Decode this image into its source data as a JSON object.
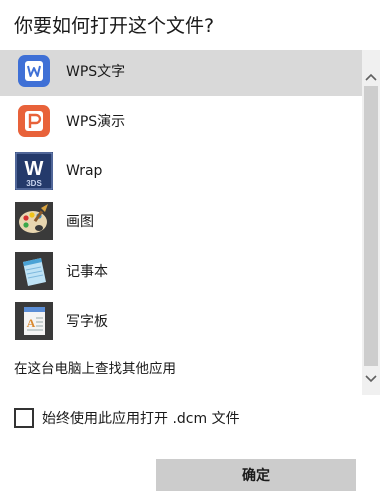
{
  "dialog": {
    "title": "你要如何打开这个文件?"
  },
  "apps": [
    {
      "label": "WPS文字",
      "icon": "wps-writer-icon",
      "color": "#3f70d6",
      "selected": true
    },
    {
      "label": "WPS演示",
      "icon": "wps-presentation-icon",
      "color": "#e8623a",
      "selected": false
    },
    {
      "label": "Wrap",
      "icon": "wrap-3ds-icon",
      "color": "#243a6b",
      "selected": false
    },
    {
      "label": "画图",
      "icon": "paint-palette-icon",
      "color": "#6a8fb0",
      "selected": false
    },
    {
      "label": "记事本",
      "icon": "notepad-icon",
      "color": "#4aa3d6",
      "selected": false
    },
    {
      "label": "写字板",
      "icon": "wordpad-icon",
      "color": "#5b8ed6",
      "selected": false
    }
  ],
  "wrap_icon_text": {
    "letter": "W",
    "sub": "3DS"
  },
  "find_more": "在这台电脑上查找其他应用",
  "always_use": {
    "label": "始终使用此应用打开 .dcm 文件",
    "checked": false
  },
  "ok_button": "确定",
  "colors": {
    "selected_bg": "#d9d9d9",
    "scrollbar_bg": "#f0f0f0",
    "scroll_thumb": "#cdcdcd",
    "ok_bg": "#cccccc"
  }
}
